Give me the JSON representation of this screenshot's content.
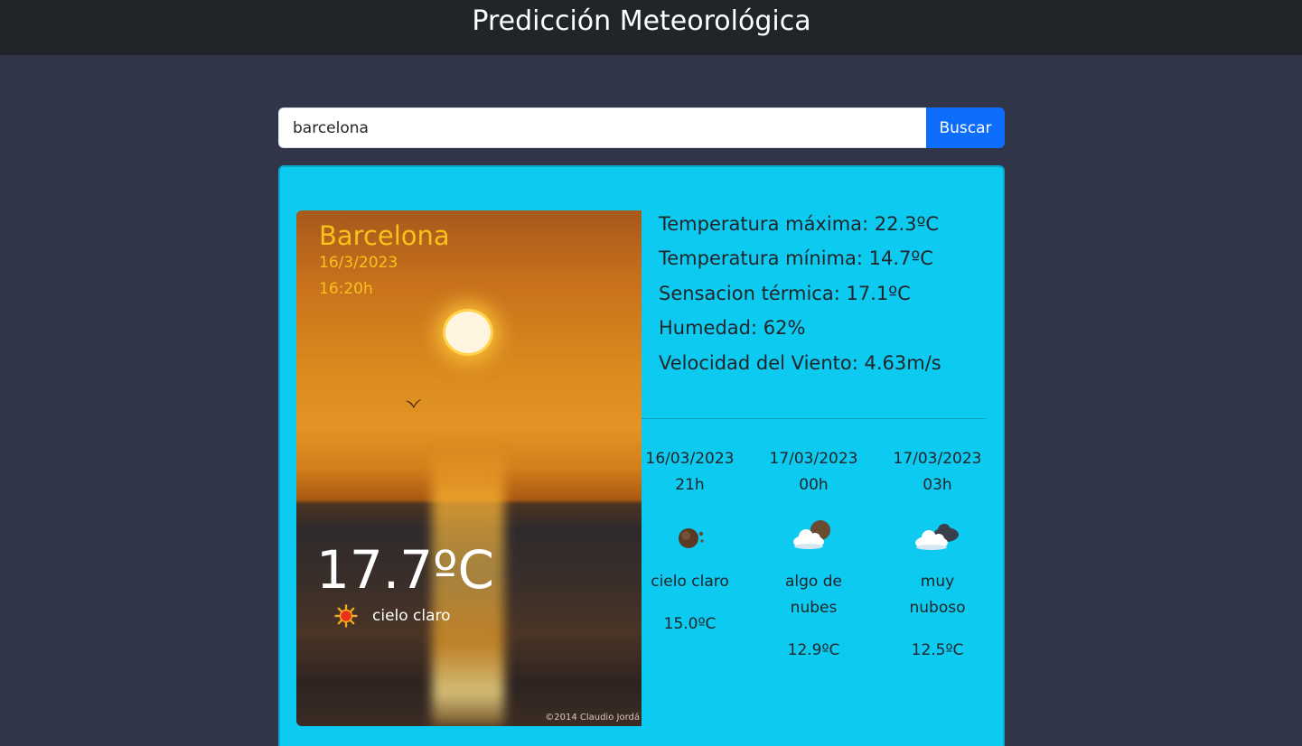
{
  "header": {
    "title": "Predicción Meteorológica"
  },
  "search": {
    "value": "barcelona",
    "button_label": "Buscar"
  },
  "current": {
    "city": "Barcelona",
    "date": "16/3/2023",
    "time": "16:20h",
    "temperature": "17.7ºC",
    "description": "cielo claro",
    "icon": "sun-icon",
    "photo_credit": "©2014 Claudio Jordá"
  },
  "stats": [
    {
      "label": "Temperatura máxima: 22.3ºC"
    },
    {
      "label": "Temperatura mínima: 14.7ºC"
    },
    {
      "label": "Sensacion térmica: 17.1ºC"
    },
    {
      "label": "Humedad: 62%"
    },
    {
      "label": "Velocidad del Viento: 4.63m/s"
    }
  ],
  "forecast": [
    {
      "date": "16/03/2023",
      "hour": "21h",
      "icon": "clear-night-icon",
      "description": "cielo claro",
      "temperature": "15.0ºC"
    },
    {
      "date": "17/03/2023",
      "hour": "00h",
      "icon": "few-clouds-night-icon",
      "description": "algo de nubes",
      "temperature": "12.9ºC"
    },
    {
      "date": "17/03/2023",
      "hour": "03h",
      "icon": "broken-clouds-icon",
      "description": "muy nuboso",
      "temperature": "12.5ºC"
    }
  ],
  "colors": {
    "background": "#30354a",
    "header": "#212529",
    "card": "#0dcaf0",
    "button": "#0d6efd",
    "city_text": "#f7c21a"
  }
}
